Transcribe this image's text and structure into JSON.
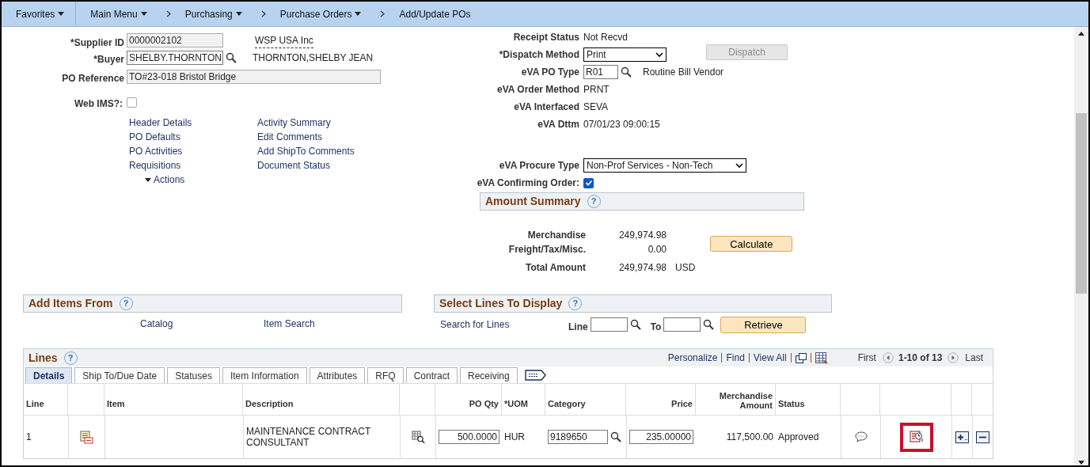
{
  "breadcrumbs": [
    {
      "label": "Favorites",
      "menu": true
    },
    {
      "label": "Main Menu",
      "menu": true
    },
    {
      "label": "Purchasing",
      "menu": true
    },
    {
      "label": "Purchase Orders",
      "menu": true
    },
    {
      "label": "Add/Update POs",
      "menu": false
    }
  ],
  "supplier": {
    "label": "*Supplier ID",
    "value": "0000002102",
    "name": "WSP USA Inc"
  },
  "buyer": {
    "label": "*Buyer",
    "value": "SHELBY.THORNTON",
    "name": "THORNTON,SHELBY JEAN"
  },
  "po_reference": {
    "label": "PO Reference",
    "value": "TO#23-018 Bristol Bridge"
  },
  "web_ims": {
    "label": "Web IMS?:",
    "checked": false
  },
  "links_left": [
    "Header Details",
    "PO Defaults",
    "PO Activities",
    "Requisitions"
  ],
  "actions": "Actions",
  "links_right": [
    "Activity Summary",
    "Edit Comments",
    "Add ShipTo Comments",
    "Document Status"
  ],
  "status_fields": [
    {
      "kind": "text",
      "label": "Receipt Status",
      "value": "Not Recvd"
    },
    {
      "kind": "select",
      "label": "*Dispatch Method",
      "value": "Print"
    },
    {
      "kind": "lookup",
      "label": "eVA PO Type",
      "value": "R01",
      "description": "Routine Bill Vendor"
    },
    {
      "kind": "text",
      "label": "eVA Order Method",
      "value": "PRNT"
    },
    {
      "kind": "text",
      "label": "eVA Interfaced",
      "value": "SEVA"
    },
    {
      "kind": "text",
      "label": "eVA Dttm",
      "value": "07/01/23 09:00:15"
    }
  ],
  "dispatch_button": {
    "label": "Dispatch",
    "disabled": true
  },
  "procurement_fields": [
    {
      "kind": "select",
      "label": "eVA Procure Type",
      "value": "Non-Prof Services - Non-Tech"
    },
    {
      "kind": "checkbox",
      "label": "eVA Confirming Order:",
      "checked": true
    }
  ],
  "amount_summary": {
    "title": "Amount Summary",
    "help": "?",
    "rows": [
      {
        "label": "Merchandise",
        "value": "249,974.98"
      },
      {
        "label": "Freight/Tax/Misc.",
        "value": "0.00"
      },
      {
        "label": "Total Amount",
        "value": "249,974.98",
        "currency": "USD"
      }
    ],
    "button": "Calculate"
  },
  "add_items": {
    "title": "Add Items From",
    "help": "?",
    "links": [
      "Catalog",
      "Item Search"
    ]
  },
  "select_lines": {
    "title": "Select Lines To Display",
    "help": "?",
    "link": "Search for Lines",
    "line_label": "Line",
    "to_label": "To",
    "button": "Retrieve"
  },
  "lines": {
    "title": "Lines",
    "help": "?",
    "toolbar": [
      "Personalize",
      "Find",
      "View All"
    ],
    "first": "First",
    "range": "1-10 of 13",
    "last": "Last",
    "tabs": [
      {
        "label": "Details",
        "selected": true
      },
      {
        "label": "Ship To/Due Date",
        "selected": false
      },
      {
        "label": "Statuses",
        "selected": false
      },
      {
        "label": "Item Information",
        "selected": false
      },
      {
        "label": "Attributes",
        "selected": false
      },
      {
        "label": "RFQ",
        "selected": false
      },
      {
        "label": "Contract",
        "selected": false
      },
      {
        "label": "Receiving",
        "selected": false
      }
    ],
    "columns": {
      "line": "Line",
      "item": "Item",
      "description": "Description",
      "po_qty": "PO Qty",
      "uom": "*UOM",
      "category": "Category",
      "price": "Price",
      "merchandise_amount": "Merchandise Amount",
      "status": "Status"
    },
    "rows": [
      {
        "line": "1",
        "description": "MAINTENANCE CONTRACT CONSULTANT",
        "po_qty": "500.0000",
        "uom": "HUR",
        "category": "9189650",
        "price": "235.00000",
        "merchandise_amount": "117,500.00",
        "status": "Approved",
        "schedule_highlighted": true
      }
    ]
  }
}
